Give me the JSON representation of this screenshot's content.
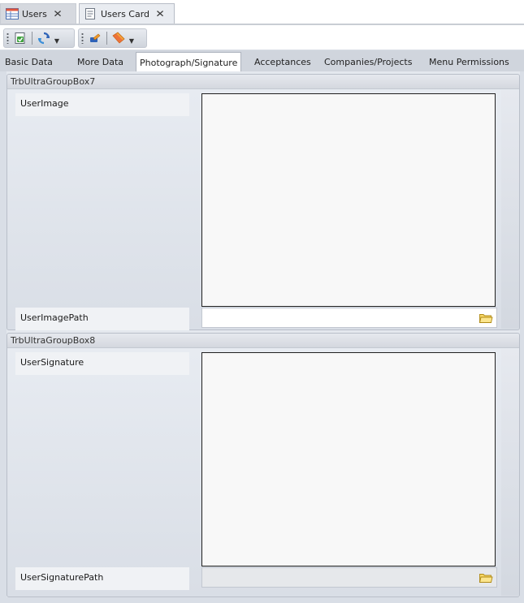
{
  "doc_tabs": [
    {
      "label": "Users"
    },
    {
      "label": "Users Card"
    }
  ],
  "page_tabs": [
    {
      "label": "Basic Data"
    },
    {
      "label": "More Data"
    },
    {
      "label": "Photograph/Signature",
      "active": true
    },
    {
      "label": "Acceptances"
    },
    {
      "label": "Companies/Projects"
    },
    {
      "label": "Menu Permissions"
    }
  ],
  "group_image": {
    "title": "TrbUltraGroupBox7",
    "image_label": "UserImage",
    "path_label": "UserImagePath",
    "path_value": ""
  },
  "group_signature": {
    "title": "TrbUltraGroupBox8",
    "image_label": "UserSignature",
    "path_label": "UserSignaturePath",
    "path_value": ""
  },
  "icons": {
    "close": "close-icon",
    "save": "save-check-icon",
    "refresh": "refresh-icon",
    "edit": "edit-icon",
    "undo": "eraser-icon",
    "folder": "folder-icon"
  },
  "colors": {
    "window_bg": "#d9dee6",
    "active_tab_bg": "#ffffff",
    "folder_yellow": "#f3d25a"
  }
}
